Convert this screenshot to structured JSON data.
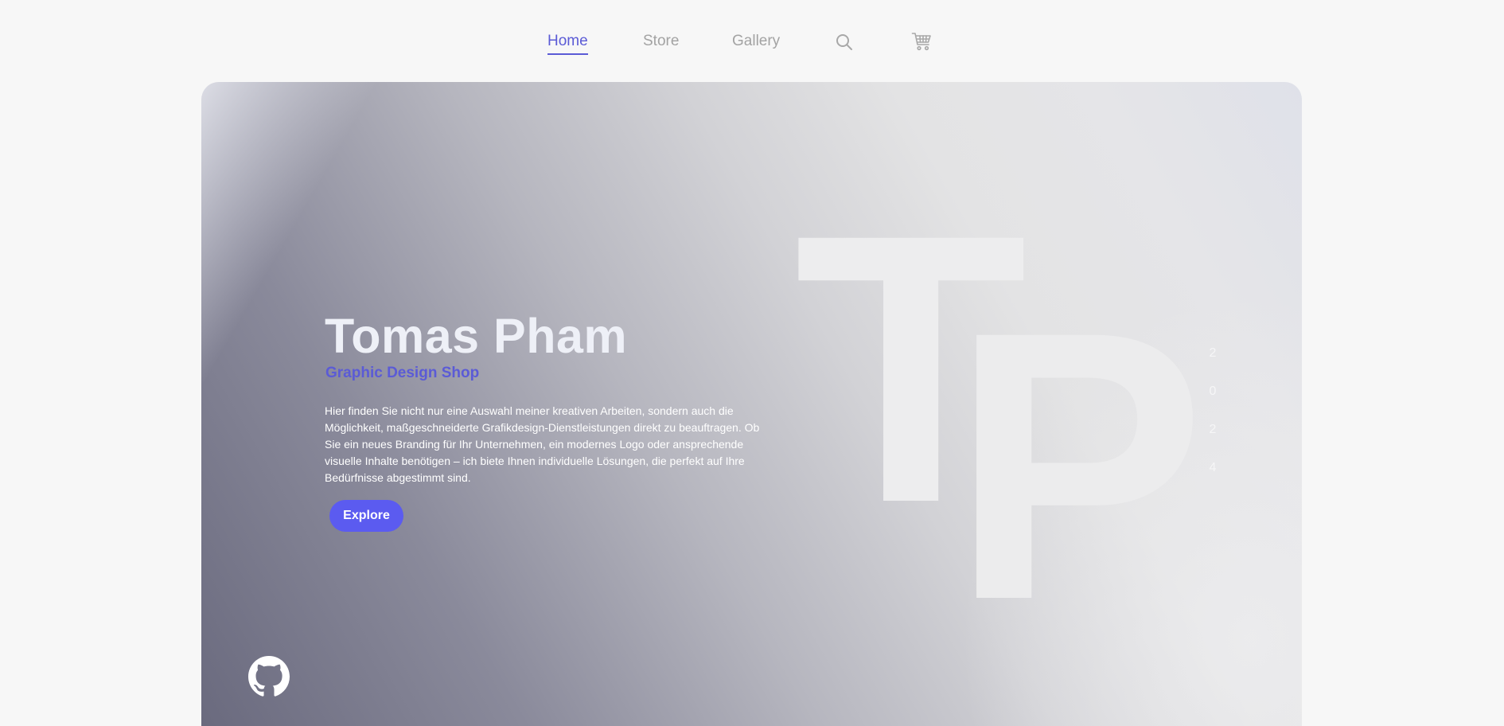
{
  "nav": {
    "items": [
      {
        "label": "Home",
        "active": true
      },
      {
        "label": "Store",
        "active": false
      },
      {
        "label": "Gallery",
        "active": false
      }
    ],
    "icons": [
      "search-icon",
      "cart-icon"
    ]
  },
  "hero": {
    "monogram": {
      "first": "T",
      "second": "P"
    },
    "year_digits": [
      "2",
      "0",
      "2",
      "4"
    ],
    "title": "Tomas Pham",
    "subtitle": "Graphic Design Shop",
    "description": "Hier finden Sie nicht nur eine Auswahl meiner kreativen Arbeiten, sondern auch die Möglichkeit, maßgeschneiderte Grafikdesign-Dienstleistungen direkt zu beauftragen. Ob Sie ein neues Branding für Ihr Unternehmen, ein modernes Logo oder ansprechende visuelle Inhalte benötigen – ich biete Ihnen individuelle Lösungen, die perfekt auf Ihre Bedürfnisse abgestimmt sind.",
    "cta_label": "Explore",
    "social_icon": "github-icon"
  },
  "colors": {
    "accent": "#5b5bd6",
    "button": "#5b5bf0",
    "page_background": "#f7f7f7",
    "nav_inactive": "#a3a3a3"
  }
}
